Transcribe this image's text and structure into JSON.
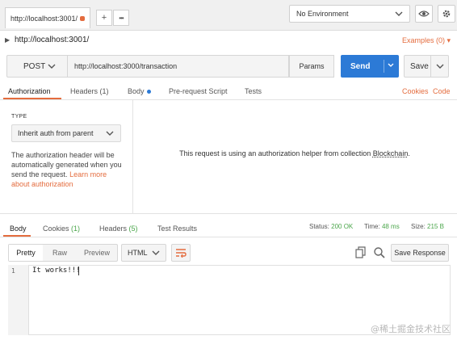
{
  "topbar": {
    "tab_title": "http://localhost:3001/",
    "add_tab": "+",
    "more_tabs": "•••",
    "environment": "No Environment"
  },
  "request": {
    "title": "http://localhost:3001/",
    "examples": "Examples (0)",
    "method": "POST",
    "url": "http://localhost:3000/transaction",
    "params": "Params",
    "send": "Send",
    "save": "Save"
  },
  "request_tabs": {
    "authorization": "Authorization",
    "headers": "Headers (1)",
    "body": "Body",
    "prerequest": "Pre-request Script",
    "tests": "Tests",
    "cookies": "Cookies",
    "code": "Code"
  },
  "auth": {
    "type_label": "TYPE",
    "type_value": "Inherit auth from parent",
    "description": "The authorization header will be automatically generated when you send the request.",
    "learn_more": "Learn more about authorization",
    "message_prefix": "This request is using an authorization helper from collection",
    "collection": "Blockchain",
    "message_suffix": "."
  },
  "response": {
    "tabs": {
      "body": "Body",
      "cookies": "Cookies",
      "cookies_count": "(1)",
      "headers": "Headers",
      "headers_count": "(5)",
      "tests": "Test Results"
    },
    "status_label": "Status:",
    "status_value": "200 OK",
    "time_label": "Time:",
    "time_value": "48 ms",
    "size_label": "Size:",
    "size_value": "215 B",
    "formats": [
      "Pretty",
      "Raw",
      "Preview"
    ],
    "language": "HTML",
    "save_response": "Save Response",
    "line_number": "1",
    "body_text": "It works!!!"
  },
  "watermark": "@稀土掘金技术社区",
  "colors": {
    "accent": "#e46c3e",
    "send": "#2c7ad6",
    "status_ok": "#4ba64b"
  }
}
